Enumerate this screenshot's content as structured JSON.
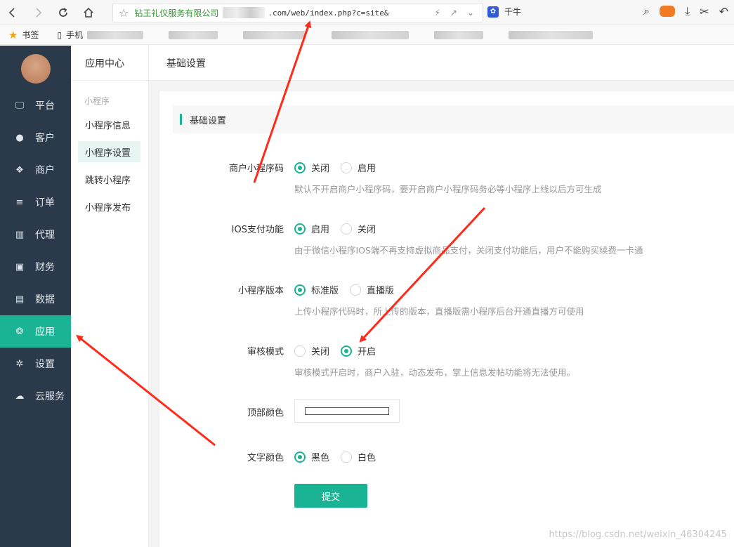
{
  "browser": {
    "site_name": "钻王礼仪服务有限公司",
    "url": ".com/web/index.php?c=site&",
    "search_engine_label": "千牛",
    "bookmarks_label": "书签",
    "bookmark_phone": "手机"
  },
  "sidebar": {
    "items": [
      {
        "label": "平台",
        "icon": "monitor-icon"
      },
      {
        "label": "客户",
        "icon": "user-icon"
      },
      {
        "label": "商户",
        "icon": "users-icon"
      },
      {
        "label": "订单",
        "icon": "list-icon"
      },
      {
        "label": "代理",
        "icon": "map-icon"
      },
      {
        "label": "财务",
        "icon": "money-icon"
      },
      {
        "label": "数据",
        "icon": "bar-chart-icon"
      },
      {
        "label": "应用",
        "icon": "cubes-icon"
      },
      {
        "label": "设置",
        "icon": "gear-icon"
      },
      {
        "label": "云服务",
        "icon": "cloud-icon"
      }
    ],
    "active_index": 7
  },
  "subnav": {
    "header": "应用中心",
    "section": "小程序",
    "items": [
      "小程序信息",
      "小程序设置",
      "跳转小程序",
      "小程序发布"
    ],
    "active_index": 1
  },
  "page": {
    "title": "基础设置",
    "section_title": "基础设置"
  },
  "form": {
    "merchant_code": {
      "label": "商户小程序码",
      "options": [
        "关闭",
        "启用"
      ],
      "selected": 0,
      "help": "默认不开启商户小程序码，要开启商户小程序码务必等小程序上线以后方可生成"
    },
    "ios_pay": {
      "label": "IOS支付功能",
      "options": [
        "启用",
        "关闭"
      ],
      "selected": 0,
      "help": "由于微信小程序IOS端不再支持虚拟商品支付，关闭支付功能后，用户不能购买续费一卡通"
    },
    "version": {
      "label": "小程序版本",
      "options": [
        "标准版",
        "直播版"
      ],
      "selected": 0,
      "help": "上传小程序代码时，所上传的版本，直播版需小程序后台开通直播方可使用"
    },
    "review_mode": {
      "label": "审核模式",
      "options": [
        "关闭",
        "开启"
      ],
      "selected": 1,
      "help": "审核模式开启时，商户入驻，动态发布，掌上信息发帖功能将无法使用。"
    },
    "top_color": {
      "label": "顶部颜色",
      "value": "#ffffff"
    },
    "text_color": {
      "label": "文字颜色",
      "options": [
        "黑色",
        "白色"
      ],
      "selected": 0
    },
    "submit_label": "提交"
  },
  "watermark": "https://blog.csdn.net/weixin_46304245",
  "colors": {
    "accent": "#1ab394",
    "sidebar_bg": "#2b3a4a",
    "arrow": "#ff2a1a"
  }
}
